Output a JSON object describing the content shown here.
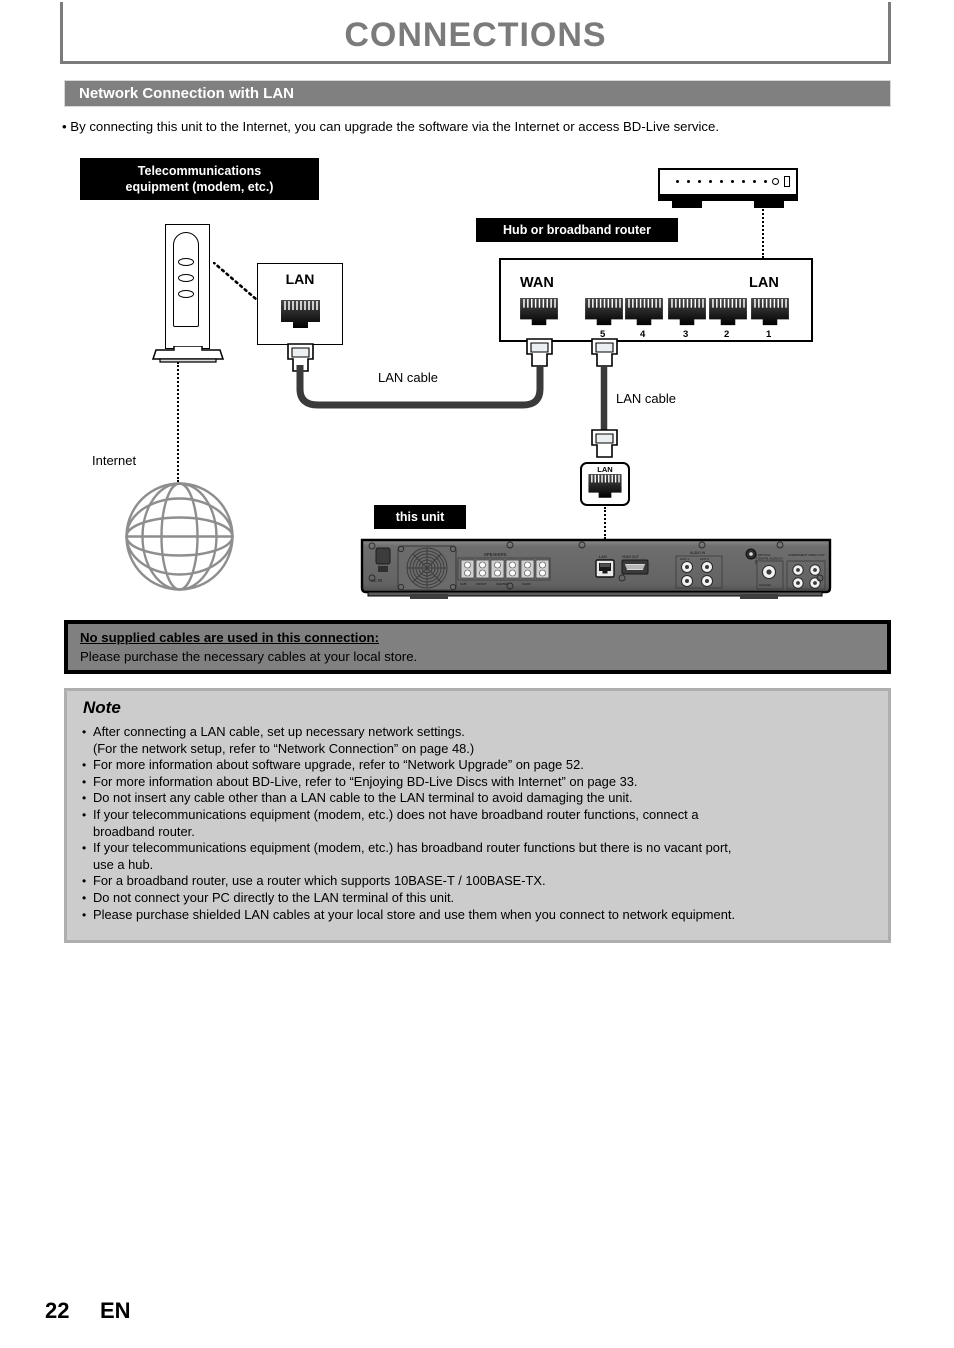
{
  "header": {
    "title": "CONNECTIONS"
  },
  "section": {
    "heading": "Network Connection with LAN",
    "intro": "• By connecting this unit to the Internet, you can upgrade the software via the Internet or access BD-Live service."
  },
  "diagram": {
    "labels": {
      "telecom_equipment": "Telecommunications\nequipment (modem, etc.)",
      "telecom_equipment_line1": "Telecommunications",
      "telecom_equipment_line2": "equipment (modem, etc.)",
      "hub_router": "Hub or broadband router",
      "this_unit": "this unit",
      "internet": "Internet",
      "lan_cable_1": "LAN cable",
      "lan_cable_2": "LAN cable"
    },
    "modem_jack": {
      "title": "LAN"
    },
    "router": {
      "wan_label": "WAN",
      "lan_label": "LAN",
      "port_numbers": [
        "5",
        "4",
        "3",
        "2",
        "1"
      ]
    },
    "unit_jack": {
      "title": "LAN"
    },
    "unit_rear_panel": {
      "ac_in": "AC IN",
      "speakers": "SPEAKERS",
      "lan_port": "LAN",
      "hdmi_out": "HDMI OUT",
      "audio_in": "AUDIO IN",
      "aux1": "AUX 1",
      "aux2": "AUX 2",
      "fm_antenna": "FM ANT",
      "optical_digital_audio_in": "OPTICAL DIGITAL AUDIO IN",
      "component_video_out": "COMPONENT VIDEO OUT"
    }
  },
  "notice": {
    "title": "No supplied cables are used in this connection:",
    "body": "Please purchase the necessary cables at your local store."
  },
  "note": {
    "title": "Note",
    "items": [
      {
        "text": "After connecting a LAN cable, set up necessary network settings.",
        "cont": "(For the network setup, refer to “Network Connection” on page 48.)"
      },
      {
        "text": "For more information about software upgrade, refer to “Network Upgrade” on page 52.",
        "cont": ""
      },
      {
        "text": "For more information about BD-Live, refer to “Enjoying BD-Live Discs with Internet” on page 33.",
        "cont": ""
      },
      {
        "text": "Do not insert any cable other than a LAN cable to the LAN terminal to avoid damaging the unit.",
        "cont": ""
      },
      {
        "text": "If your telecommunications equipment (modem, etc.) does not have broadband router functions, connect a",
        "cont": "broadband router."
      },
      {
        "text": "If your telecommunications equipment (modem, etc.) has broadband router functions but there is no vacant port,",
        "cont": "use a hub."
      },
      {
        "text": "For a broadband router, use a router which supports 10BASE-T / 100BASE-TX.",
        "cont": ""
      },
      {
        "text": "Do not connect your PC directly to the LAN terminal of this unit.",
        "cont": ""
      },
      {
        "text": "Please purchase shielded LAN cables at your local store and use them when you connect to network equipment.",
        "cont": ""
      }
    ]
  },
  "footer": {
    "page_number": "22",
    "language": "EN"
  },
  "colors": {
    "header_gray": "#7b7b7b",
    "section_gray": "#808080",
    "note_gray": "#cccccc",
    "black": "#000000",
    "cable": "#3a3a3a"
  }
}
